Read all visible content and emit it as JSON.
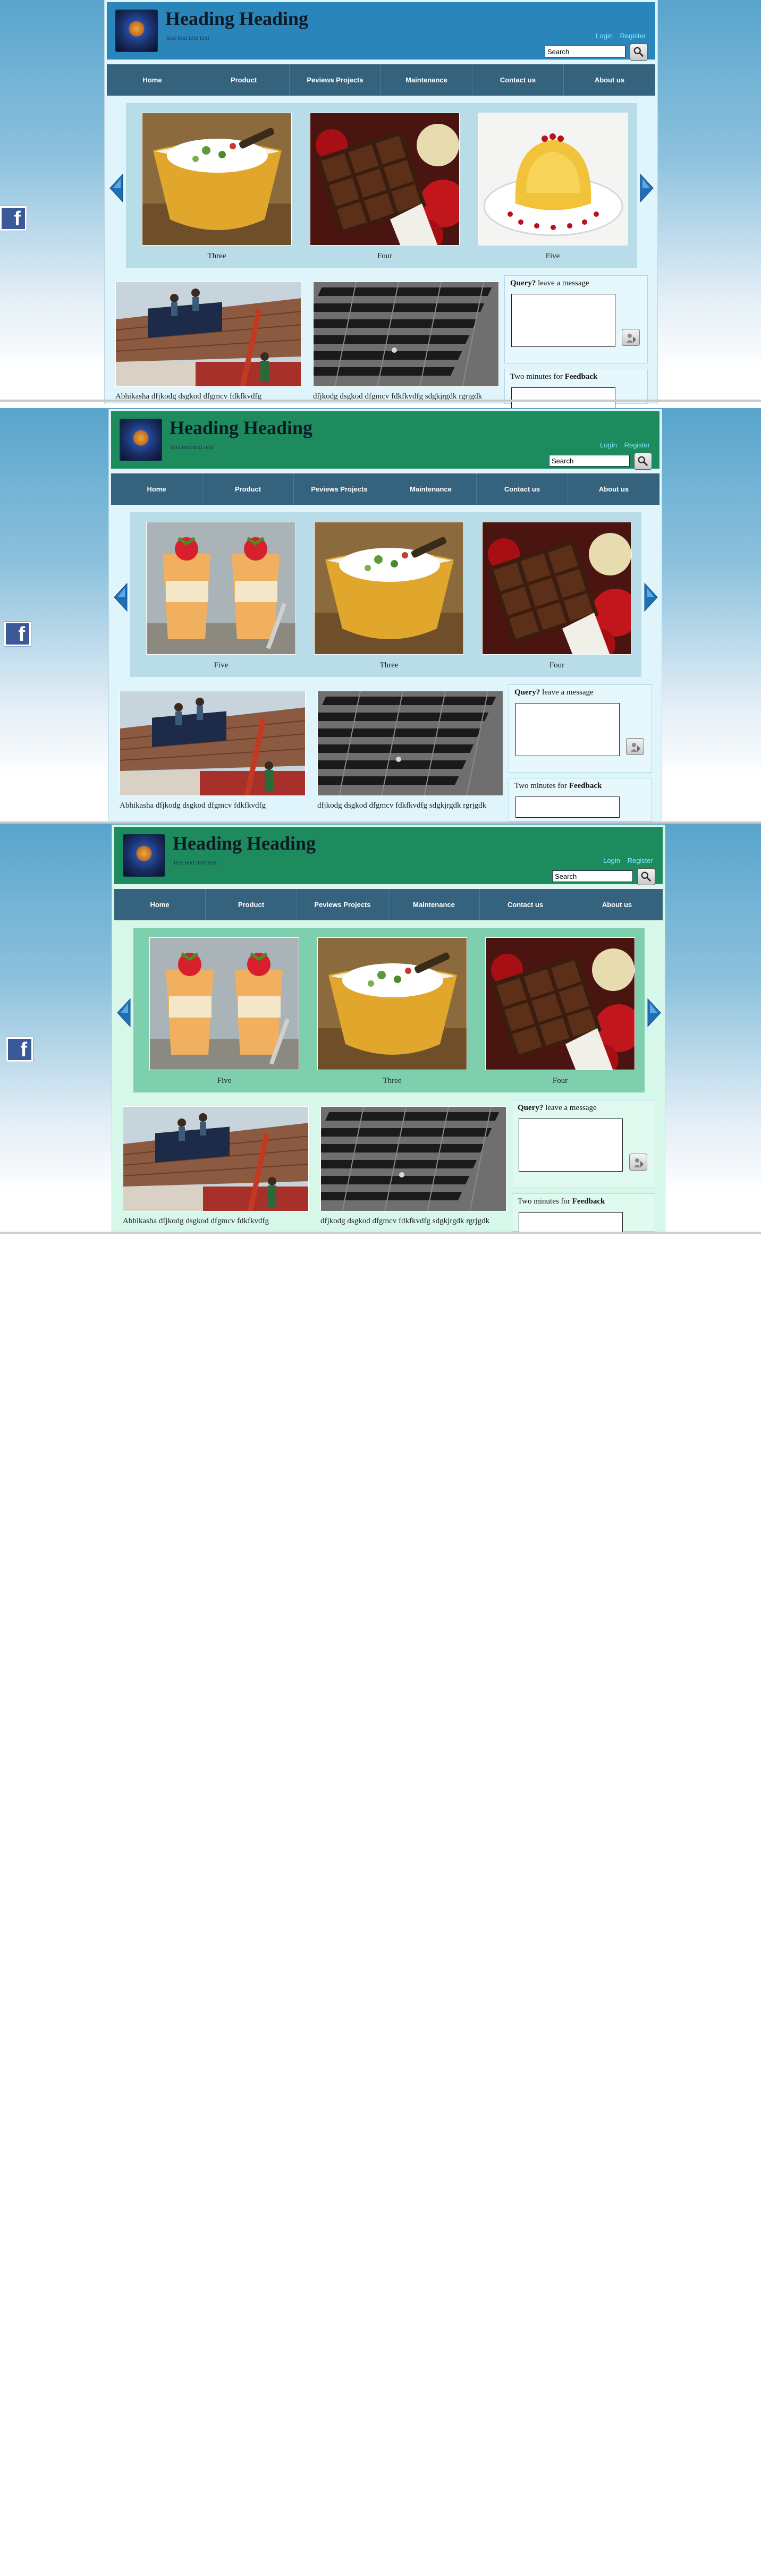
{
  "site": {
    "title": "Heading Heading",
    "subtitle": "text text text text"
  },
  "header_links": {
    "login": "Login",
    "register": "Register"
  },
  "search": {
    "value": "Search"
  },
  "nav": [
    "Home",
    "Product",
    "Peviews Projects",
    "Maintenance",
    "Contact us",
    "About us"
  ],
  "facebook_label": "f",
  "captions": {
    "one": "Three",
    "two": "Four",
    "three": "Five"
  },
  "variants": [
    {
      "slides": [
        "Three",
        "Four",
        "Five"
      ]
    },
    {
      "slides": [
        "Five",
        "Three",
        "Four"
      ]
    },
    {
      "slides": [
        "Five",
        "Three",
        "Four"
      ]
    }
  ],
  "thumbs": {
    "left": "Abhikasha dfjkodg dsgkod dfgmcv fdkfkvdfg",
    "right": "dfjkodg dsgkod dfgmcv fdkfkvdfg sdgkjrgdk rgrjgdk"
  },
  "query": {
    "bold": "Query?",
    "rest": " leave a message"
  },
  "feedback": {
    "pre": "Two minutes for ",
    "bold": "Feedback"
  },
  "colors": {
    "blue_header": "#2a86ba",
    "green_header": "#1e8b5f",
    "nav": "#35627d",
    "link": "#7ff0ff"
  }
}
